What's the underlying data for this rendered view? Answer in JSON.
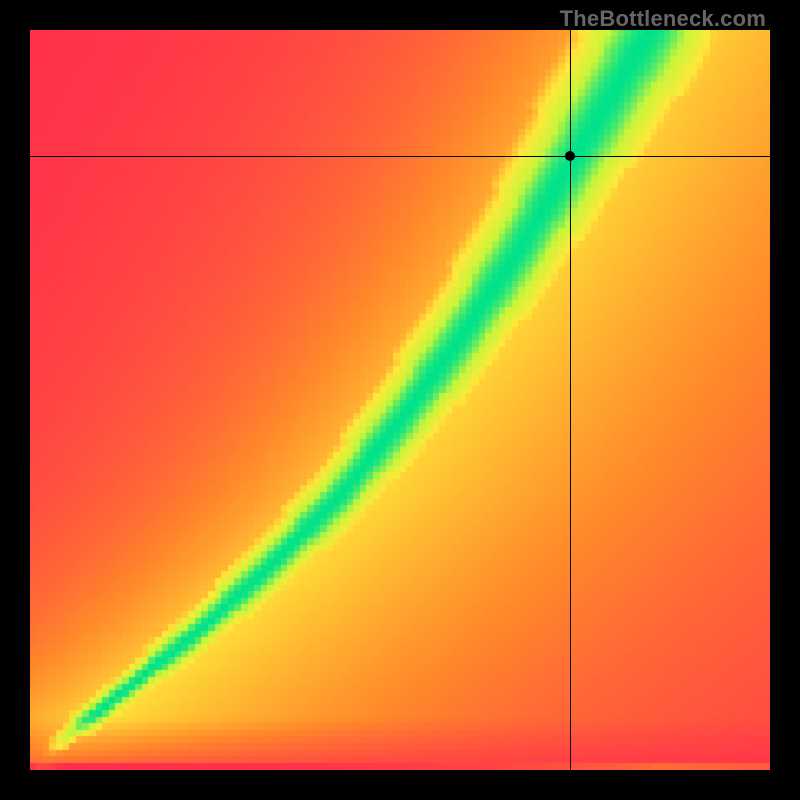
{
  "watermark": "TheBottleneck.com",
  "chart_data": {
    "type": "heatmap",
    "title": "",
    "xlabel": "",
    "ylabel": "",
    "xlim": [
      0,
      100
    ],
    "ylim": [
      0,
      100
    ],
    "colorscale": [
      {
        "stop": 0.0,
        "color": "#ff2a4d"
      },
      {
        "stop": 0.25,
        "color": "#ff8a2a"
      },
      {
        "stop": 0.5,
        "color": "#ffe83a"
      },
      {
        "stop": 0.78,
        "color": "#c8f53a"
      },
      {
        "stop": 1.0,
        "color": "#00e28a"
      }
    ],
    "ridge_path": [
      {
        "x": 1,
        "y": 1
      },
      {
        "x": 12,
        "y": 10
      },
      {
        "x": 22,
        "y": 18
      },
      {
        "x": 32,
        "y": 27
      },
      {
        "x": 42,
        "y": 37
      },
      {
        "x": 50,
        "y": 47
      },
      {
        "x": 58,
        "y": 58
      },
      {
        "x": 66,
        "y": 70
      },
      {
        "x": 72,
        "y": 80
      },
      {
        "x": 78,
        "y": 90
      },
      {
        "x": 84,
        "y": 100
      }
    ],
    "corner_fitness": {
      "bottom_left": 0.0,
      "bottom_right": 0.0,
      "top_left": 0.0,
      "top_right": 0.5
    },
    "crosshair": {
      "x": 73,
      "y": 83
    },
    "ridge_intersects_crosshair": true
  },
  "plot": {
    "grid_cells": 112,
    "pixelated": true
  },
  "colors": {
    "background": "#000000",
    "watermark": "#666666",
    "crosshair": "#000000"
  }
}
